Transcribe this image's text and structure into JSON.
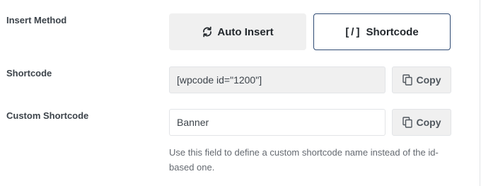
{
  "insert_method": {
    "label": "Insert Method",
    "auto_insert_label": "Auto Insert",
    "shortcode_icon": "[/]",
    "shortcode_label": "Shortcode",
    "selected": "Shortcode"
  },
  "shortcode": {
    "label": "Shortcode",
    "value": "[wpcode id=\"1200\"]",
    "copy_label": "Copy"
  },
  "custom_shortcode": {
    "label": "Custom Shortcode",
    "value": "Banner",
    "copy_label": "Copy",
    "help_text": "Use this field to define a custom shortcode name instead of the id-based one."
  },
  "icons": {
    "auto_insert": "refresh-icon",
    "copy": "copy-icon"
  },
  "colors": {
    "selected_border": "#2f4a73",
    "button_bg": "#f0f0f0"
  }
}
